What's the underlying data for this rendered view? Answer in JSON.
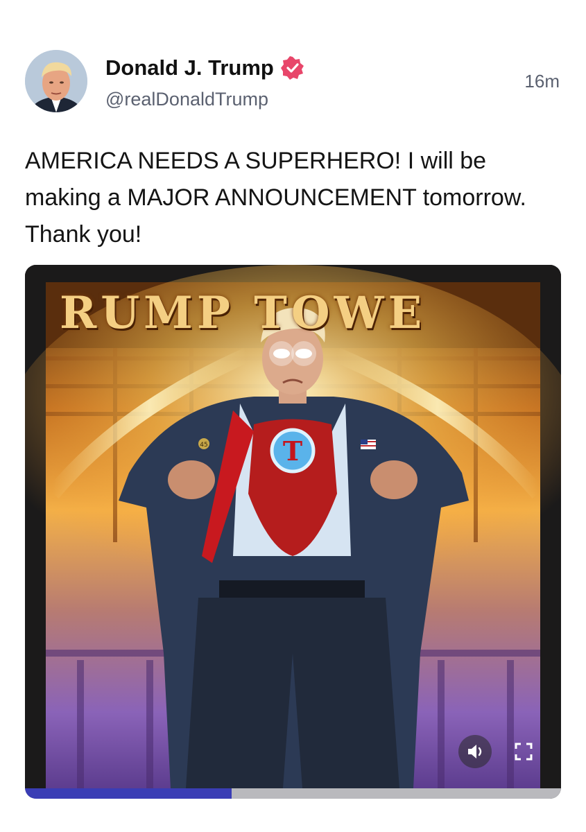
{
  "post": {
    "author": {
      "display_name": "Donald J. Trump",
      "handle": "@realDonaldTrump",
      "verified": true
    },
    "timestamp": "16m",
    "text": "AMERICA NEEDS A SUPERHERO! I will be making a MAJOR ANNOUNCEMENT tomorrow. Thank you!",
    "media": {
      "sign_text": "RUMP TOWE",
      "chest_emblem": "T",
      "pin_text": "45",
      "progress_fraction": 0.385
    }
  },
  "icons": {
    "verified": "verified-badge-icon",
    "volume": "speaker-icon",
    "fullscreen": "fullscreen-icon"
  },
  "colors": {
    "verified_badge": "#e8466a",
    "progress_fill": "#3a3db5",
    "progress_track": "#b9b9bd",
    "secondary_text": "#5b6170"
  }
}
